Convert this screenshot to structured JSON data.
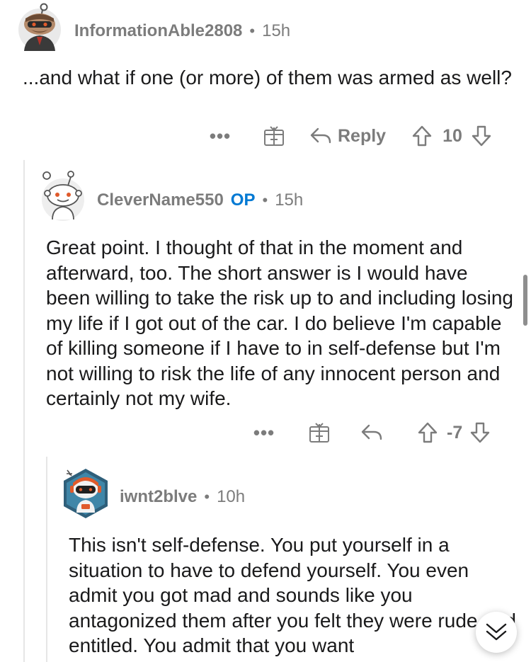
{
  "comments": [
    {
      "username": "InformationAble2808",
      "age": "15h",
      "body": "...and what if one (or more) of them was armed as well?",
      "actions": {
        "more": "•••",
        "reply_label": "Reply",
        "score": "10"
      }
    },
    {
      "username": "CleverName550",
      "op_badge": "OP",
      "age": "15h",
      "body": "Great point. I thought of that in the moment and afterward, too. The short answer is I would have been willing to take the risk up to and including losing my life if I got out of the car. I do believe I'm capable of killing someone if I have to in self-defense but I'm not willing to risk the life of any innocent person and certainly not my wife.",
      "actions": {
        "more": "•••",
        "score": "-7"
      }
    },
    {
      "username": "iwnt2blve",
      "age": "10h",
      "body": "This isn't self-defense. You put yourself in a situation to have to defend yourself. You even admit you got mad and sounds like you antagonized them after you felt they were rude and entitled. You admit that you want"
    }
  ],
  "separator": "•",
  "icons": {
    "more": "more-options-icon",
    "award": "award-gift-icon",
    "reply": "reply-arrow-icon",
    "upvote": "upvote-arrow-icon",
    "downvote": "downvote-arrow-icon",
    "collapse": "chevron-double-down-icon"
  },
  "colors": {
    "text": "#1a1a1b",
    "meta": "#7c7c7c",
    "op_badge": "#0079d3",
    "thread_line": "#e6e6e6"
  }
}
